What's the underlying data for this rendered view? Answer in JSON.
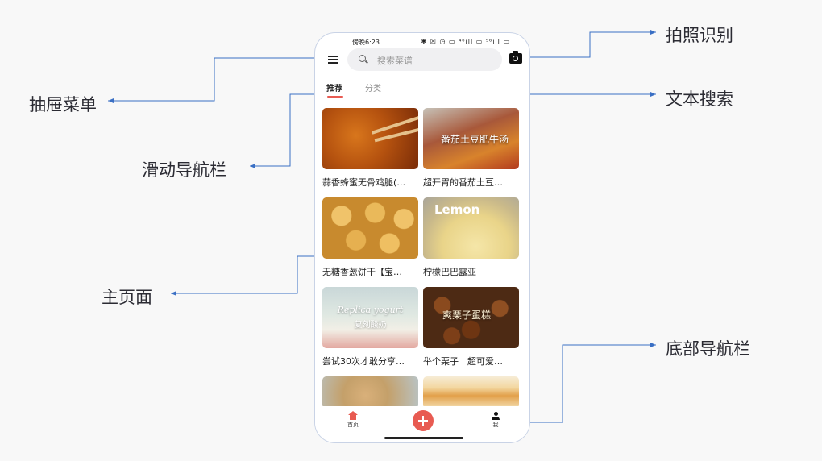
{
  "annotations": {
    "camera": "拍照识别",
    "drawer": "抽屉菜单",
    "search": "文本搜索",
    "nav_tabs": "滑动导航栏",
    "main_page": "主页面",
    "bottom_nav": "底部导航栏",
    "arrow_color": "#3a6fc4"
  },
  "status_bar": {
    "time": "傍晚6:23",
    "icons_text": "✱ ☒ ◷ ▭ ⁴⁶ıll ▭ ⁵⁶ıll ▭"
  },
  "header": {
    "menu_icon": "hamburger-icon",
    "search_icon": "magnifier-icon",
    "search_placeholder": "搜索菜谱",
    "camera_icon": "camera-icon"
  },
  "tabs": [
    {
      "label": "推荐",
      "active": true
    },
    {
      "label": "分类",
      "active": false
    }
  ],
  "accent_color": "#e85b52",
  "recipes": [
    {
      "title": "蒜香蜂蜜无骨鸡腿(…"
    },
    {
      "title": "超开胃的番茄土豆…",
      "overlay": "番茄土豆肥牛汤"
    },
    {
      "title": "无糖香葱饼干【宝…"
    },
    {
      "title": "柠檬巴巴露亚",
      "overlay": "Lemon"
    },
    {
      "title": "尝试30次才敢分享…",
      "overlay": "Replica yogurt",
      "overlay2": "复刻酸奶"
    },
    {
      "title": "举个栗子丨超可爱…",
      "overlay": "爽栗子蛋糕"
    },
    {
      "title": ""
    },
    {
      "title": ""
    }
  ],
  "bottom_nav": {
    "home_label": "首页",
    "home_icon": "home-icon",
    "add_icon": "plus-icon",
    "me_label": "我",
    "me_icon": "user-icon"
  }
}
